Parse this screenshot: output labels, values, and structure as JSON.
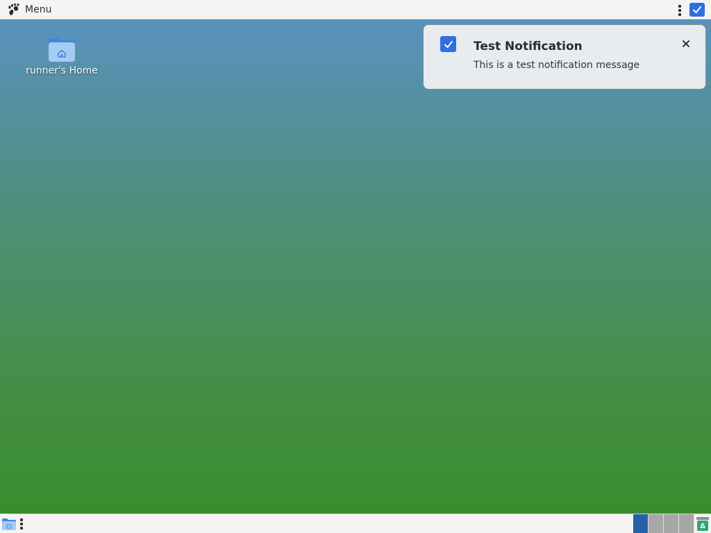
{
  "top_panel": {
    "menu_label": "Menu",
    "menu_icon": "gnome-foot-icon",
    "tray_icon": "notification-checkbox-icon"
  },
  "desktop": {
    "background_top": "#5a92bd",
    "background_bottom": "#3b8d2b",
    "icons": [
      {
        "label": "runner's Home",
        "icon": "home-folder-icon"
      }
    ]
  },
  "notification": {
    "title": "Test Notification",
    "body": "This is a test notification message",
    "app_icon": "checkbox-icon",
    "close_icon": "close-icon",
    "accent": "#2f6fe0"
  },
  "bottom_panel": {
    "launcher_icon": "folder-icon",
    "workspaces": [
      {
        "name": "workspace-1",
        "active": true
      },
      {
        "name": "workspace-2",
        "active": false
      },
      {
        "name": "workspace-3",
        "active": false
      },
      {
        "name": "workspace-4",
        "active": false
      }
    ],
    "trash_icon": "trash-icon"
  }
}
